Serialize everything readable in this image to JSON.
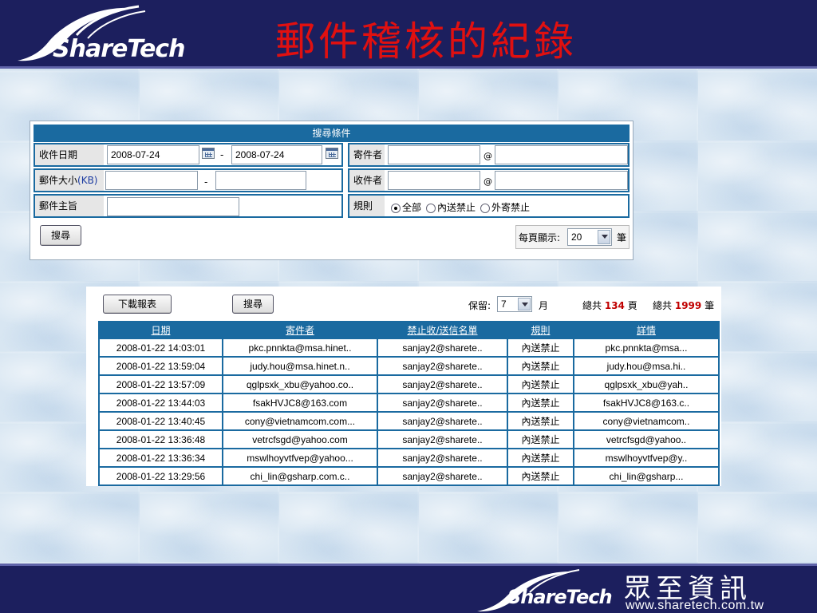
{
  "header": {
    "logo_text": "ShareTech",
    "title": "郵件稽核的紀錄"
  },
  "footer": {
    "logo_text": "ShareTech",
    "company_cn": "眾至資訊",
    "website": "www.sharetech.com.tw"
  },
  "search": {
    "title": "搜尋條件",
    "received_date_label": "收件日期",
    "date_from": "2008-07-24",
    "date_to": "2008-07-24",
    "range_separator": "-",
    "sender_label": "寄件者",
    "size_label_prefix": "郵件大小",
    "size_label_unit": "(KB)",
    "recipient_label": "收件者",
    "at_sign": "@",
    "subject_label": "郵件主旨",
    "rule_label": "規則",
    "rule_options": [
      "全部",
      "內送禁止",
      "外寄禁止"
    ],
    "selected_rule": "全部",
    "search_button": "搜尋",
    "per_page_label": "每頁顯示:",
    "per_page_value": "20",
    "per_page_unit": "筆"
  },
  "results": {
    "download_button": "下載報表",
    "search_button": "搜尋",
    "retain_label": "保留:",
    "retain_value": "7",
    "retain_unit": "月",
    "total_pages_prefix": "總共",
    "total_pages": "134",
    "total_pages_unit": "頁",
    "total_items_prefix": "總共",
    "total_items": "1999",
    "total_items_unit": "筆",
    "columns": [
      "日期",
      "寄件者",
      "禁止收/送信名單",
      "規則",
      "詳情"
    ],
    "rows": [
      [
        "2008-01-22 14:03:01",
        "pkc.pnnkta@msa.hinet..",
        "sanjay2@sharete..",
        "內送禁止",
        "pkc.pnnkta@msa..."
      ],
      [
        "2008-01-22 13:59:04",
        "judy.hou@msa.hinet.n..",
        "sanjay2@sharete..",
        "內送禁止",
        "judy.hou@msa.hi.."
      ],
      [
        "2008-01-22 13:57:09",
        "qglpsxk_xbu@yahoo.co..",
        "sanjay2@sharete..",
        "內送禁止",
        "qglpsxk_xbu@yah.."
      ],
      [
        "2008-01-22 13:44:03",
        "fsakHVJC8@163.com",
        "sanjay2@sharete..",
        "內送禁止",
        "fsakHVJC8@163.c.."
      ],
      [
        "2008-01-22 13:40:45",
        "cony@vietnamcom.com...",
        "sanjay2@sharete..",
        "內送禁止",
        "cony@vietnamcom.."
      ],
      [
        "2008-01-22 13:36:48",
        "vetrcfsgd@yahoo.com",
        "sanjay2@sharete..",
        "內送禁止",
        "vetrcfsgd@yahoo.."
      ],
      [
        "2008-01-22 13:36:34",
        "mswlhoyvtfvep@yahoo...",
        "sanjay2@sharete..",
        "內送禁止",
        "mswlhoyvtfvep@y.."
      ],
      [
        "2008-01-22 13:29:56",
        "chi_lin@gsharp.com.c..",
        "sanjay2@sharete..",
        "內送禁止",
        "chi_lin@gsharp..."
      ]
    ]
  },
  "colors": {
    "header_bg": "#1c1f5e",
    "title_red": "#e01010",
    "table_blue": "#1a6aa0",
    "highlight_red": "#c00000"
  }
}
